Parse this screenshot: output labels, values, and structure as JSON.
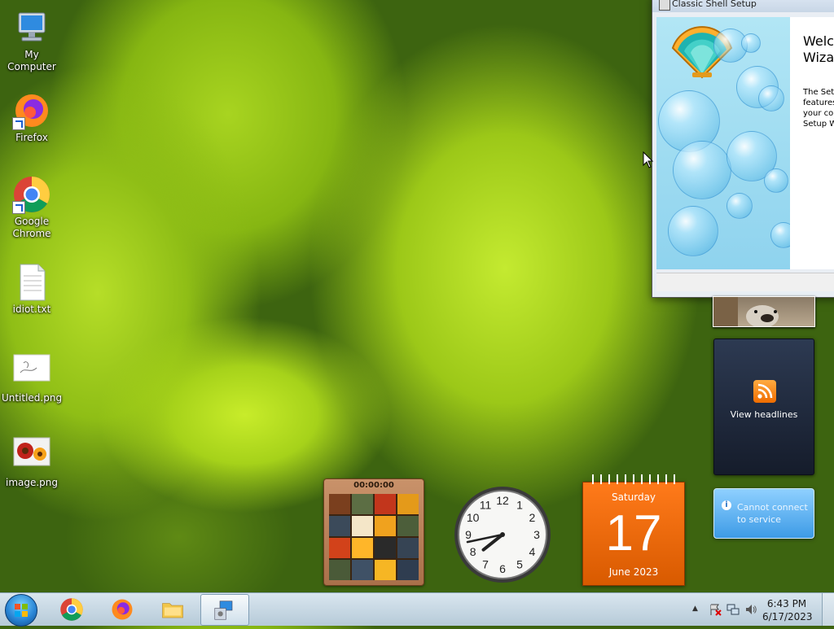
{
  "desktop": {
    "icons": [
      {
        "label": "My Computer"
      },
      {
        "label": "Firefox"
      },
      {
        "label": "Google Chrome"
      },
      {
        "label": "idiot.txt"
      },
      {
        "label": "Untitled.png"
      },
      {
        "label": "image.png"
      }
    ]
  },
  "setup_window": {
    "title": "Classic Shell Setup",
    "heading_line1": "Welco",
    "heading_line2": "Wizar",
    "body_lines": [
      "The Setu",
      "features",
      "your cor",
      "Setup W"
    ]
  },
  "gadgets": {
    "feed": {
      "label": "View headlines"
    },
    "weather": {
      "message": "Cannot connect to service"
    },
    "puzzle": {
      "timer": "00:00:00"
    },
    "clock": {
      "hour": 7,
      "minute": 43
    },
    "calendar": {
      "weekday": "Saturday",
      "day": "17",
      "month_year": "June 2023"
    }
  },
  "taskbar": {
    "time": "6:43 PM",
    "date": "6/17/2023",
    "pinned": [
      "chrome-icon",
      "firefox-icon",
      "explorer-icon",
      "setup-icon"
    ]
  }
}
